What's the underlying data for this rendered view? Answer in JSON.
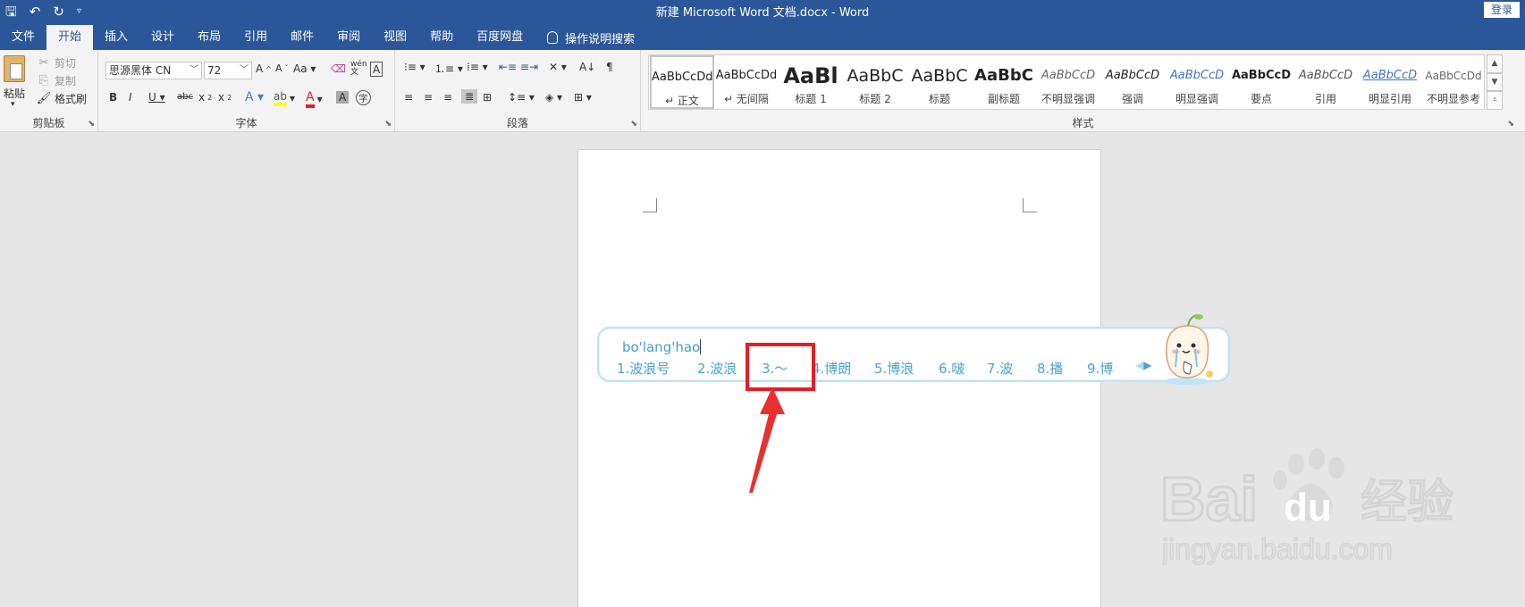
{
  "title_bar": {
    "title": "新建 Microsoft Word 文档.docx  -  Word",
    "login_label": "登录"
  },
  "tabs": [
    "文件",
    "开始",
    "插入",
    "设计",
    "布局",
    "引用",
    "邮件",
    "审阅",
    "视图",
    "帮助",
    "百度网盘"
  ],
  "active_tab": "开始",
  "tell_me": "操作说明搜索",
  "clipboard": {
    "label": "剪贴板",
    "paste": "粘贴",
    "cut": "剪切",
    "copy": "复制",
    "format_painter": "格式刷"
  },
  "font": {
    "label": "字体",
    "font_name": "思源黑体 CN",
    "font_size": "72"
  },
  "paragraph": {
    "label": "段落"
  },
  "styles": {
    "label": "样式",
    "items": [
      {
        "sample": "AaBbCcDd",
        "name": "↵ 正文"
      },
      {
        "sample": "AaBbCcDd",
        "name": "↵ 无间隔"
      },
      {
        "sample": "AaBl",
        "name": "标题 1"
      },
      {
        "sample": "AaBbC",
        "name": "标题 2"
      },
      {
        "sample": "AaBbC",
        "name": "标题"
      },
      {
        "sample": "AaBbC",
        "name": "副标题"
      },
      {
        "sample": "AaBbCcD",
        "name": "不明显强调"
      },
      {
        "sample": "AaBbCcD",
        "name": "强调"
      },
      {
        "sample": "AaBbCcD",
        "name": "明显强调"
      },
      {
        "sample": "AaBbCcD",
        "name": "要点"
      },
      {
        "sample": "AaBbCcD",
        "name": "引用"
      },
      {
        "sample": "AaBbCcD",
        "name": "明显引用"
      },
      {
        "sample": "AaBbCcDd",
        "name": "不明显参考"
      }
    ]
  },
  "ime": {
    "input": "bo'lang'hao",
    "candidates": [
      "1.波浪号",
      "2.波浪",
      "3.～",
      "4.博朗",
      "5.博浪",
      "6.啵",
      "7.波",
      "8.播",
      "9.博"
    ]
  },
  "watermark": {
    "brand": "Bai",
    "brand_tail": "du",
    "cn": "经验",
    "url": "jingyan.baidu.com"
  },
  "colors": {
    "accent": "#2b579a",
    "ime_text": "#4aa3cf",
    "highlight": "#e41e26"
  }
}
